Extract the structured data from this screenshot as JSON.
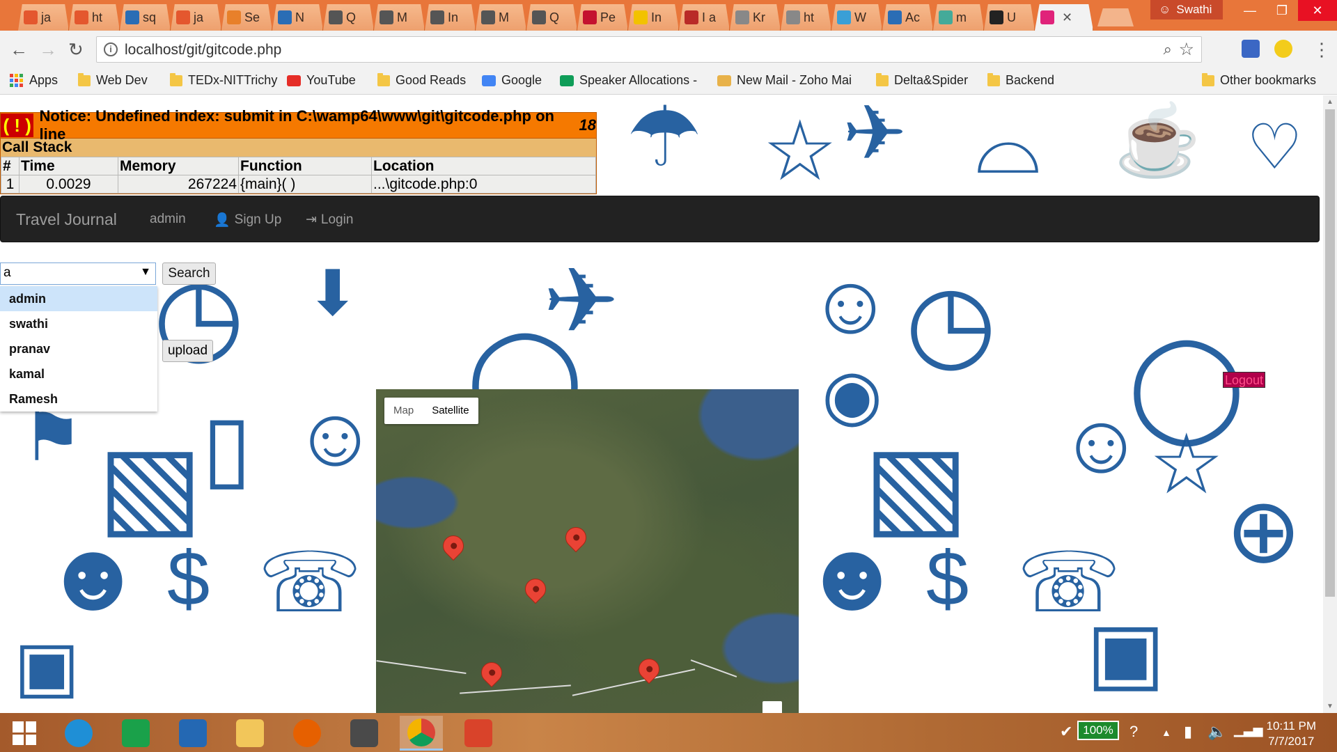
{
  "browser": {
    "tabs": [
      {
        "label": "ja",
        "fav": "java",
        "color": "#e4572e"
      },
      {
        "label": "ht",
        "fav": "html",
        "color": "#e4572e"
      },
      {
        "label": "sq",
        "fav": "sql",
        "color": "#2a6db5"
      },
      {
        "label": "ja",
        "fav": "java",
        "color": "#e4572e"
      },
      {
        "label": "Se",
        "fav": "stackoverflow",
        "color": "#e8802a"
      },
      {
        "label": "N",
        "fav": "infinity",
        "color": "#2a6db5"
      },
      {
        "label": "Q",
        "fav": "chart",
        "color": "#555"
      },
      {
        "label": "M",
        "fav": "chart",
        "color": "#555"
      },
      {
        "label": "In",
        "fav": "chart",
        "color": "#555"
      },
      {
        "label": "M",
        "fav": "chart",
        "color": "#555"
      },
      {
        "label": "Q",
        "fav": "chart",
        "color": "#555"
      },
      {
        "label": "Pe",
        "fav": "hbr",
        "color": "#c4122f"
      },
      {
        "label": "In",
        "fav": "hand",
        "color": "#f2c200"
      },
      {
        "label": "I a",
        "fav": "quora",
        "color": "#b92b27"
      },
      {
        "label": "Kr",
        "fav": "page",
        "color": "#888"
      },
      {
        "label": "ht",
        "fav": "doc",
        "color": "#888"
      },
      {
        "label": "W",
        "fav": "windows",
        "color": "#3a9fd6"
      },
      {
        "label": "Ac",
        "fav": "bookmark",
        "color": "#2a6db5"
      },
      {
        "label": "m",
        "fav": "db",
        "color": "#4a9"
      },
      {
        "label": "U",
        "fav": "github",
        "color": "#222"
      },
      {
        "label": "",
        "fav": "w",
        "color": "#e0237a",
        "active": true
      }
    ],
    "profile_name": "Swathi",
    "url": "localhost/git/gitcode.php",
    "bookmarks": [
      {
        "label": "Apps",
        "icon": "apps-grid-icon"
      },
      {
        "label": "Web Dev",
        "icon": "folder-icon"
      },
      {
        "label": "TEDx-NITTrichy",
        "icon": "folder-icon"
      },
      {
        "label": "YouTube",
        "icon": "youtube-icon"
      },
      {
        "label": "Good Reads",
        "icon": "folder-icon"
      },
      {
        "label": "Google",
        "icon": "google-icon"
      },
      {
        "label": "Speaker Allocations -",
        "icon": "sheets-icon"
      },
      {
        "label": "New Mail - Zoho Mai",
        "icon": "mail-icon"
      },
      {
        "label": "Delta&Spider",
        "icon": "folder-icon"
      },
      {
        "label": "Backend",
        "icon": "folder-icon"
      }
    ],
    "other_bookmarks": "Other bookmarks"
  },
  "notice": {
    "bang": "( ! )",
    "message": "Notice: Undefined index: submit in C:\\wamp64\\www\\git\\gitcode.php on line ",
    "line": "18",
    "call_stack_title": "Call Stack",
    "headers": [
      "#",
      "Time",
      "Memory",
      "Function",
      "Location"
    ],
    "row": [
      "1",
      "0.0029",
      "267224",
      "{main}( )",
      "...\\gitcode.php:0"
    ]
  },
  "navbar": {
    "brand": "Travel Journal",
    "admin": "admin",
    "signup": "Sign Up",
    "login": "Login"
  },
  "search": {
    "value": "a",
    "button": "Search",
    "options": [
      "admin",
      "swathi",
      "pranav",
      "kamal",
      "Ramesh"
    ],
    "highlighted_index": 0
  },
  "upload_button": "upload",
  "logout_label": "Logout",
  "map": {
    "type_map": "Map",
    "type_satellite": "Satellite",
    "selected_type": "Satellite",
    "marker_count": 5
  },
  "taskbar": {
    "battery": "100%",
    "time": "10:11 PM",
    "date": "7/7/2017"
  }
}
